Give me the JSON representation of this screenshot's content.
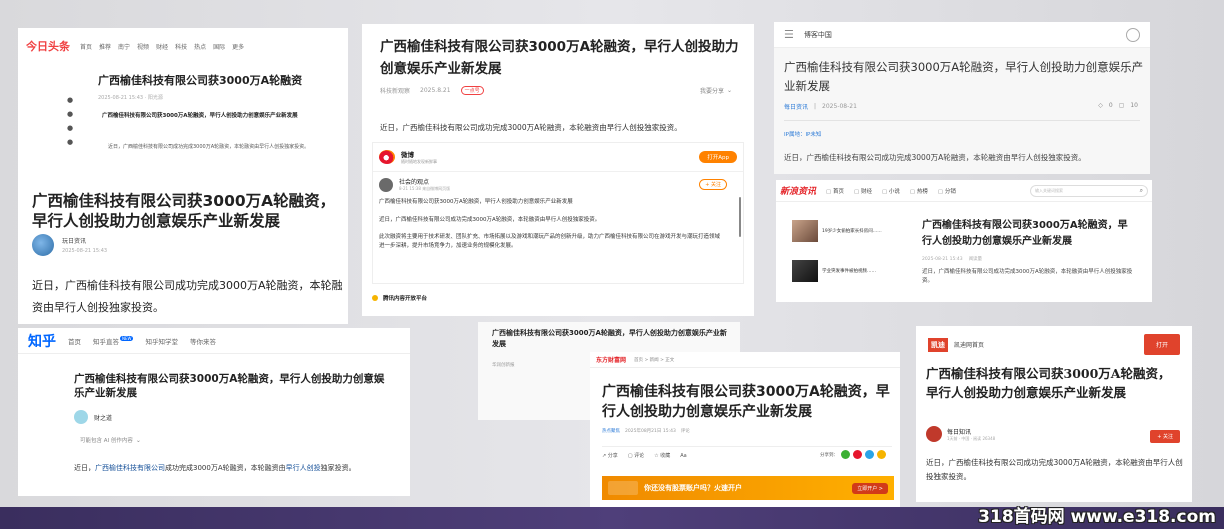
{
  "main_title": "广西榆佳科技有限公司获3000万A轮融资，早行人创投助力创意娱乐产业新发展",
  "main_title_short": "广西榆佳科技有限公司获3000万A轮融资",
  "intro": "近日，广西榆佳科技有限公司成功完成3000万A轮融资，本轮融资由早行人创投独家投资。",
  "toutiao": {
    "logo": "今日头条",
    "nav": [
      "首页",
      "推荐",
      "南宁",
      "视频",
      "财经",
      "科技",
      "热点",
      "国际",
      "更多"
    ],
    "date": "2025-08-21 15:43 · 阳光源",
    "author": "玩日资讯",
    "author_date": "2025-08-21 15:43",
    "body_line1": "近日，广西榆佳科技有限公司成功完成3000万A轮融资，本轮融",
    "body_line2": "资由早行人创投独家投资。"
  },
  "kejixian": {
    "source": "科技新观察",
    "date": "2025.8.21",
    "tag": "一点号",
    "share": "我要分享",
    "weibo_name": "微博",
    "weibo_sub": "随时随地发现新鲜事",
    "weibo_btn": "打开App",
    "user": "社会的观点",
    "user_meta": "8-21 15:38 来自微博网页版",
    "follow": "+ 关注",
    "p1": "广西榆佳科技有限公司获3000万A轮融资，早行人创投助力创意娱乐产业新发展",
    "p2": "近日，广西榆佳科技有限公司成功完成3000万A轮融资，本轮融资由早行人创投独家投资。",
    "p3": "此次融资将主要用于技术研发、团队扩充、市场拓展以及游戏和潮玩产品的创新升级，助力广西榆佳科技有限公司在游戏开发与潮玩打造领域进一步深耕，提升市场竞争力，加速业务的规模化发展。",
    "footer": "腾讯内容开放平台"
  },
  "bokee": {
    "site": "博客中国",
    "source": "每日资讯",
    "date": "2025-08-21",
    "stats": [
      "0",
      "10"
    ],
    "ip": "IP属地：IP未知"
  },
  "xinwen": {
    "logo": "新浪资讯",
    "nav": [
      "首页",
      "财经",
      "小说",
      "热榜",
      "分销"
    ],
    "search_placeholder": "输入关键词搜索",
    "side1": "19岁少女偷拍家长抖房间……",
    "side2": "学业突发事件被拍视频……",
    "meta": "2025-08-21 15:43",
    "reads": "阅读量"
  },
  "zhihu": {
    "logo": "知乎",
    "nav": [
      "首页",
      "知乎直答",
      "知乎知学堂",
      "等你来答"
    ],
    "new_badge": "NEW",
    "author": "财之道",
    "ai_line": "可能包含 AI 创作内容",
    "body_pre": "近日，",
    "body_link1": "广西榆佳科技有限公司",
    "body_mid": "成功完成3000万A轮融资，本轮融资由",
    "body_link2": "早行人创投",
    "body_post": "独家投资。"
  },
  "middle": {
    "title": "广西榆佳科技有限公司获3000万A轮融资，早行人创投助力创意娱乐产业新发展",
    "meta": "华润创新报"
  },
  "eastmoney": {
    "logo": "东方财富网",
    "crumb": "首页 > 新闻 > 正文",
    "source": "热点聚焦",
    "date": "2025年08月21日 15:43",
    "comment": "评论",
    "toolbar": [
      "分享",
      "评论",
      "收藏",
      "Aa"
    ],
    "share_label": "分享到：",
    "banner": "你还没有股票账户吗？火速开户",
    "banner_btn": "立即开户 >"
  },
  "kaidi": {
    "logo": "凯迪",
    "site": "凯迪网首页",
    "open_btn": "打开",
    "author": "每日知讯",
    "meta": "1天前 · 中国 · 阅读 26348",
    "follow": "+ 关注",
    "body": "近日，广西榆佳科技有限公司成功完成3000万A轮融资，本轮融资由早行人创投独家投资。"
  },
  "watermark": "318首码网 www.e318.com",
  "colors": {
    "toutiao_red": "#f04142",
    "zhihu_blue": "#0066ff",
    "weibo_orange": "#ff8200",
    "eastmoney_orange": "#ff8a00",
    "kaidi_red": "#e0432c"
  }
}
